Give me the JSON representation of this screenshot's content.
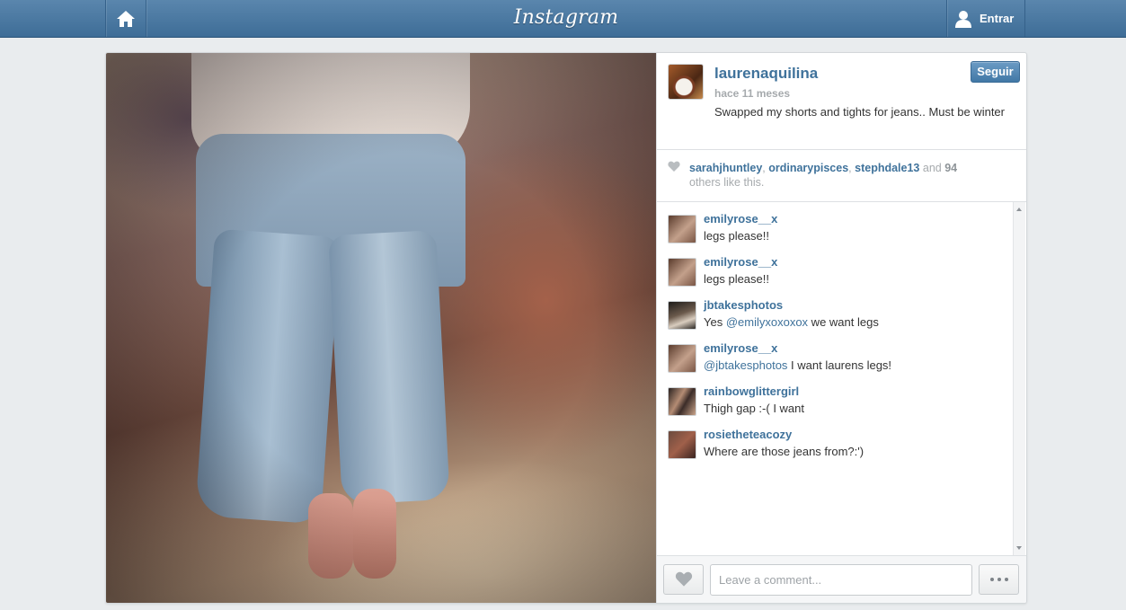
{
  "topbar": {
    "logo": "Instagram",
    "home_icon": "home-icon",
    "login_label": "Entrar",
    "login_icon": "user-silhouette-icon",
    "bar_color": "#4a7aa3"
  },
  "post": {
    "username": "laurenaquilina",
    "time": "hace 11 meses",
    "caption": "Swapped my shorts and tights for jeans.. Must be winter",
    "follow_label": "Seguir",
    "likes": {
      "users": [
        "sarahjhuntley",
        "ordinarypisces",
        "stephdale13"
      ],
      "sep1": ", ",
      "sep2": ", ",
      "and": " and ",
      "count": "94",
      "suffix": "others like this."
    }
  },
  "comments": [
    {
      "user": "emilyrose__x",
      "text": "legs please!!"
    },
    {
      "user": "emilyrose__x",
      "text": "legs please!!"
    },
    {
      "user": "jbtakesphotos",
      "prefix": "Yes ",
      "mention": "@emilyxoxoxox",
      "text": " we want legs"
    },
    {
      "user": "emilyrose__x",
      "prefix": "",
      "mention": "@jbtakesphotos",
      "text": " I want laurens legs!"
    },
    {
      "user": "rainbowglittergirl",
      "text": "Thigh gap :-( I want"
    },
    {
      "user": "rosietheteacozy",
      "text": "Where are those jeans from?:')"
    }
  ],
  "composer": {
    "placeholder": "Leave a comment...",
    "like_icon": "heart-icon",
    "more_icon": "ellipsis-icon"
  }
}
